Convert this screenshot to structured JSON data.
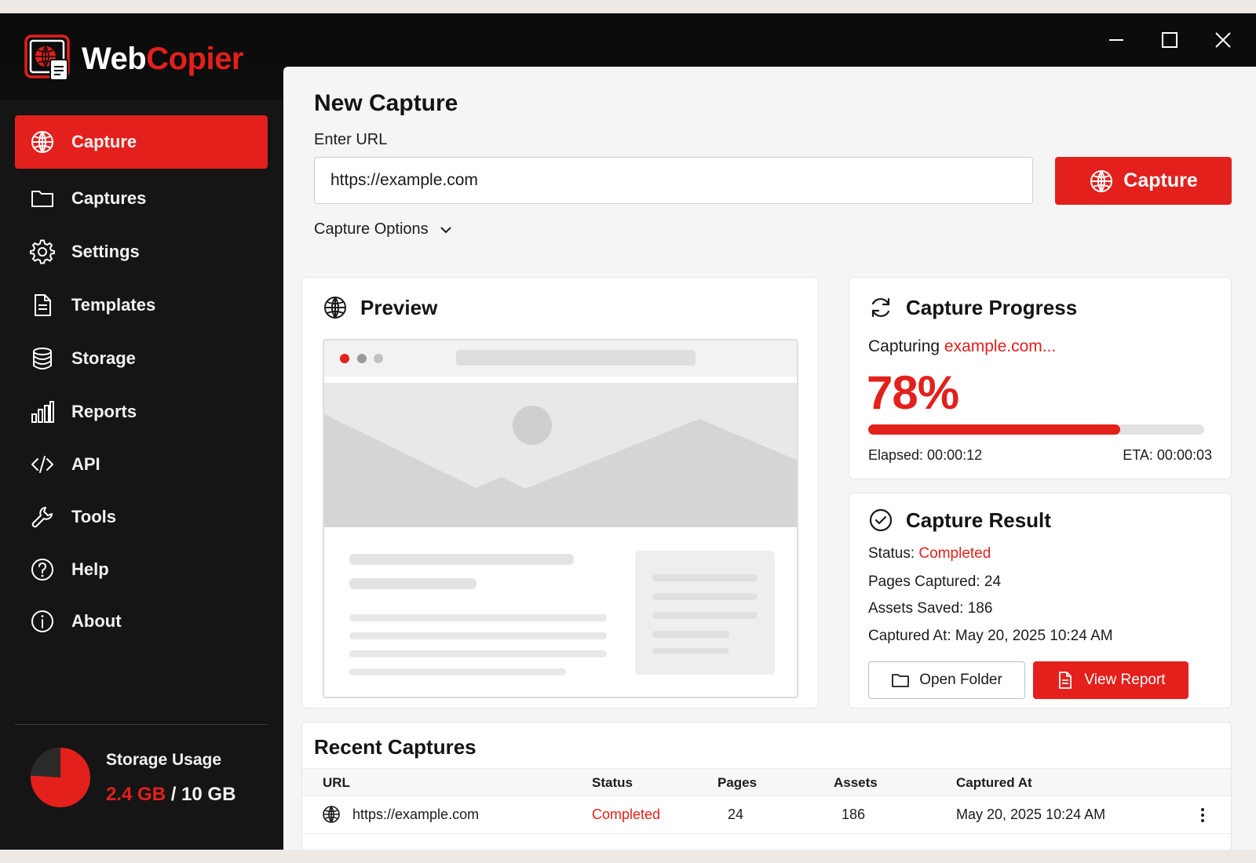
{
  "app": {
    "brand_part1": "Web",
    "brand_part2": "Copier"
  },
  "sidebar": {
    "items": [
      {
        "label": "Capture",
        "icon": "globe-icon",
        "active": true
      },
      {
        "label": "Captures",
        "icon": "folder-icon"
      },
      {
        "label": "Settings",
        "icon": "gear-icon"
      },
      {
        "label": "Templates",
        "icon": "document-icon"
      },
      {
        "label": "Storage",
        "icon": "database-icon"
      },
      {
        "label": "Reports",
        "icon": "bar-chart-icon"
      },
      {
        "label": "API",
        "icon": "code-icon"
      },
      {
        "label": "Tools",
        "icon": "wrench-icon"
      },
      {
        "label": "Help",
        "icon": "help-icon"
      },
      {
        "label": "About",
        "icon": "info-icon"
      }
    ],
    "storage": {
      "title": "Storage Usage",
      "used": "2.4 GB",
      "separator": " / ",
      "total": "10 GB",
      "used_fraction": 0.24
    }
  },
  "main": {
    "title": "New Capture",
    "url_label": "Enter URL",
    "url_value": "https://example.com",
    "capture_button": "Capture",
    "capture_options": "Capture Options"
  },
  "preview": {
    "title": "Preview"
  },
  "progress": {
    "title": "Capture Progress",
    "capturing_prefix": "Capturing ",
    "capturing_target": "example.com...",
    "percent_label": "78%",
    "percent_value": 0.75,
    "elapsed": "Elapsed: 00:00:12",
    "eta": "ETA: 00:00:03"
  },
  "result": {
    "title": "Capture Result",
    "status_label": "Status: ",
    "status_value": "Completed",
    "pages": "Pages Captured: 24",
    "assets": "Assets Saved: 186",
    "captured_at": "Captured At: May 20, 2025 10:24 AM",
    "open_folder": "Open Folder",
    "view_report": "View Report"
  },
  "recent": {
    "title": "Recent Captures",
    "columns": [
      "URL",
      "Status",
      "Pages",
      "Assets",
      "Captured At"
    ],
    "rows": [
      {
        "url": "https://example.com",
        "status": "Completed",
        "pages": "24",
        "assets": "186",
        "captured_at": "May 20, 2025 10:24 AM"
      }
    ]
  },
  "colors": {
    "accent": "#e3201c",
    "sidebar_bg": "#151515",
    "titlebar_bg": "#0c0c0c",
    "main_bg": "#f5f5f5"
  }
}
